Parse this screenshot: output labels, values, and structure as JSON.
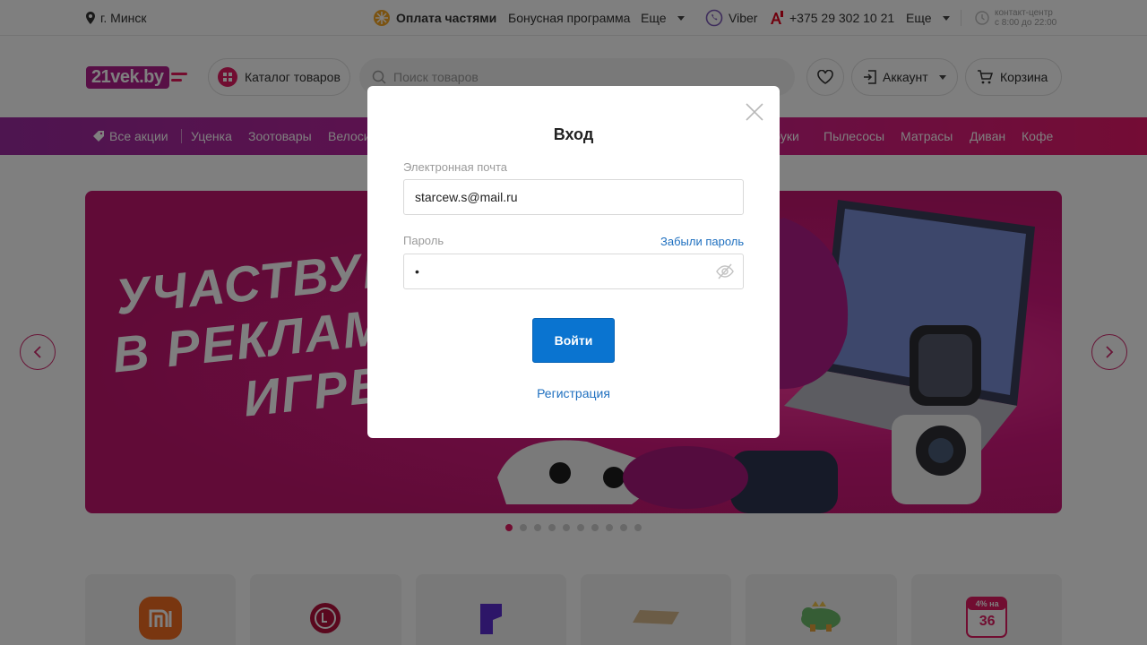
{
  "topbar": {
    "city": "г. Минск",
    "pay_parts": "Оплата частями",
    "bonus": "Бонусная программа",
    "more1": "Еще",
    "viber": "Viber",
    "phone": "+375 29 302 10 21",
    "more2": "Еще",
    "contact_line1": "контакт-центр",
    "contact_line2": "с 8:00 до 22:00"
  },
  "header": {
    "logo": "21vek.by",
    "catalog": "Каталог товаров",
    "search_placeholder": "Поиск товаров",
    "account": "Аккаунт",
    "cart": "Корзина"
  },
  "promo_nav": {
    "items": [
      "Все акции",
      "Уценка",
      "Зоотовары",
      "Велосипеды",
      "Ноутбуки",
      "Пылесосы",
      "Матрасы",
      "Диван",
      "Кофе"
    ]
  },
  "banner": {
    "lines": [
      "УЧАСТВУЙ",
      "В РЕКЛАМ",
      "ИГРЕ"
    ],
    "dots_total": 10,
    "active_dot": 0
  },
  "tiles": {
    "count": 6,
    "badge_top": "4% на",
    "badge_bottom": "36"
  },
  "modal": {
    "title": "Вход",
    "email_label": "Электронная почта",
    "email_value": "starcew.s@mail.ru",
    "password_label": "Пароль",
    "password_value": "•",
    "forgot": "Забыли пароль",
    "login_button": "Войти",
    "register": "Регистрация"
  },
  "colors": {
    "brand_pink": "#e21b62",
    "brand_purple": "#b01e8c",
    "link_blue": "#1e6fbf",
    "button_blue": "#0a74d0"
  }
}
